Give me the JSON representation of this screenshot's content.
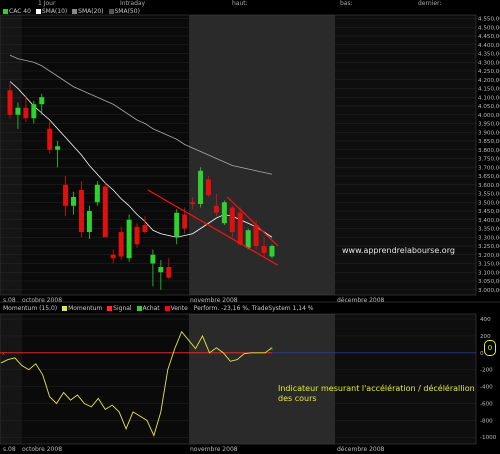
{
  "header": {
    "period": "1 Jour",
    "mode": "Intraday",
    "high_label": "haut:",
    "low_label": "bas:",
    "last_label": "dernier:"
  },
  "price_legend": [
    "CAC 40",
    "SMA(10)",
    "SMA(20)",
    "SMA(50)"
  ],
  "momentum_legend": {
    "items": [
      "Momentum (15,0)",
      "Momentum",
      "Signal",
      "Achat",
      "Vente"
    ],
    "perf": "Perform. -23,16 %, TradeSystem 1,14 %"
  },
  "watermark": "www.apprendrelabourse.org",
  "annotation": [
    "Indicateur mesurant l'accélération / décélérallion",
    "des cours"
  ],
  "bottom_box_value": "0",
  "x_labels": [
    "s.08",
    "octobre 2008",
    "novembre 2008",
    "décembre 2008"
  ],
  "colors": {
    "up": "#2fd12f",
    "down": "#e01010",
    "sma10": "#ffffff",
    "sma20": "#aaaaaa",
    "trend": "#ff1010",
    "momentum": "#e8e840",
    "signal": "#ff2a2a",
    "annotation": "#e8e840"
  },
  "chart_data": [
    {
      "type": "candlestick",
      "title": "CAC 40",
      "yticks": [
        "4.550,00",
        "4.500,00",
        "4.450,00",
        "4.400,00",
        "4.350,00",
        "4.300,00",
        "4.250,00",
        "4.200,00",
        "4.150,00",
        "4.100,00",
        "4.050,00",
        "4.000,00",
        "3.950,00",
        "3.900,00",
        "3.850,00",
        "3.800,00",
        "3.750,00",
        "3.700,00",
        "3.650,00",
        "3.600,00",
        "3.550,00",
        "3.500,00",
        "3.450,00",
        "3.400,00",
        "3.350,00",
        "3.300,00",
        "3.250,00",
        "3.200,00",
        "3.150,00",
        "3.100,00",
        "3.050,00",
        "3.000,00"
      ],
      "ylim": [
        2970,
        4570
      ],
      "candles": [
        {
          "o": 4140,
          "h": 4180,
          "l": 3980,
          "c": 4000
        },
        {
          "o": 4000,
          "h": 4070,
          "l": 3920,
          "c": 4040
        },
        {
          "o": 4040,
          "h": 4110,
          "l": 3960,
          "c": 3980
        },
        {
          "o": 3980,
          "h": 4080,
          "l": 3950,
          "c": 4060
        },
        {
          "o": 4060,
          "h": 4120,
          "l": 4000,
          "c": 4100
        },
        {
          "o": 3920,
          "h": 3960,
          "l": 3780,
          "c": 3800
        },
        {
          "o": 3800,
          "h": 3850,
          "l": 3700,
          "c": 3820
        },
        {
          "o": 3600,
          "h": 3650,
          "l": 3420,
          "c": 3480
        },
        {
          "o": 3480,
          "h": 3560,
          "l": 3430,
          "c": 3530
        },
        {
          "o": 3570,
          "h": 3620,
          "l": 3300,
          "c": 3330
        },
        {
          "o": 3330,
          "h": 3480,
          "l": 3290,
          "c": 3450
        },
        {
          "o": 3500,
          "h": 3620,
          "l": 3480,
          "c": 3600
        },
        {
          "o": 3590,
          "h": 3610,
          "l": 3300,
          "c": 3300
        },
        {
          "o": 3200,
          "h": 3230,
          "l": 3150,
          "c": 3180
        },
        {
          "o": 3330,
          "h": 3360,
          "l": 3170,
          "c": 3190
        },
        {
          "o": 3180,
          "h": 3430,
          "l": 3160,
          "c": 3400
        },
        {
          "o": 3360,
          "h": 3380,
          "l": 3240,
          "c": 3260
        },
        {
          "o": 3370,
          "h": 3420,
          "l": 3320,
          "c": 3330
        },
        {
          "o": 3150,
          "h": 3230,
          "l": 3020,
          "c": 3200
        },
        {
          "o": 3100,
          "h": 3170,
          "l": 3000,
          "c": 3130
        },
        {
          "o": 3130,
          "h": 3180,
          "l": 3060,
          "c": 3070
        },
        {
          "o": 3300,
          "h": 3460,
          "l": 3260,
          "c": 3440
        },
        {
          "o": 3430,
          "h": 3470,
          "l": 3320,
          "c": 3350
        },
        {
          "o": 3500,
          "h": 3530,
          "l": 3460,
          "c": 3490
        },
        {
          "o": 3490,
          "h": 3700,
          "l": 3470,
          "c": 3680
        },
        {
          "o": 3630,
          "h": 3650,
          "l": 3530,
          "c": 3540
        },
        {
          "o": 3480,
          "h": 3550,
          "l": 3420,
          "c": 3440
        },
        {
          "o": 3380,
          "h": 3510,
          "l": 3370,
          "c": 3500
        },
        {
          "o": 3470,
          "h": 3480,
          "l": 3300,
          "c": 3330
        },
        {
          "o": 3440,
          "h": 3470,
          "l": 3250,
          "c": 3260
        },
        {
          "o": 3240,
          "h": 3350,
          "l": 3230,
          "c": 3340
        },
        {
          "o": 3370,
          "h": 3400,
          "l": 3230,
          "c": 3250
        },
        {
          "o": 3250,
          "h": 3300,
          "l": 3180,
          "c": 3210
        },
        {
          "o": 3190,
          "h": 3260,
          "l": 3180,
          "c": 3250
        }
      ],
      "sma10": [
        4190,
        4150,
        4100,
        4050,
        4010,
        3970,
        3920,
        3870,
        3820,
        3770,
        3710,
        3660,
        3610,
        3570,
        3520,
        3480,
        3430,
        3390,
        3340,
        3320,
        3310,
        3300,
        3310,
        3320,
        3350,
        3380,
        3410,
        3430,
        3420,
        3400,
        3380,
        3360,
        3330,
        3300
      ],
      "sma20": [
        4340,
        4320,
        4310,
        4300,
        4280,
        4250,
        4220,
        4190,
        4160,
        4140,
        4120,
        4100,
        4080,
        4060,
        4030,
        4000,
        3970,
        3950,
        3920,
        3900,
        3880,
        3860,
        3830,
        3810,
        3790,
        3770,
        3750,
        3730,
        3710,
        3700,
        3690,
        3680,
        3670,
        3660
      ],
      "trendlines": [
        {
          "x1": 18,
          "y1": 3570,
          "x2": 33,
          "y2": 3140
        },
        {
          "x1": 28,
          "y1": 3530,
          "x2": 33,
          "y2": 3250
        }
      ],
      "watermark": "www.apprendrelabourse.org"
    },
    {
      "type": "line",
      "title": "Momentum (15,0)",
      "yticks": [
        "400",
        "200",
        "0",
        "-200",
        "-400",
        "-600",
        "-800",
        "-1000"
      ],
      "ylim": [
        -1080,
        460
      ],
      "momentum": [
        -120,
        -80,
        -60,
        -150,
        -200,
        -130,
        -260,
        -520,
        -600,
        -470,
        -560,
        -500,
        -600,
        -640,
        -540,
        -670,
        -620,
        -700,
        -900,
        -700,
        -750,
        -800,
        -980,
        -700,
        -200,
        50,
        250,
        150,
        50,
        200,
        0,
        60,
        0,
        -100,
        -80,
        -10,
        0,
        0,
        0,
        60
      ],
      "signal_level": 0,
      "annotation": "Indicateur mesurant l'accélération / décélérallion des cours"
    }
  ]
}
